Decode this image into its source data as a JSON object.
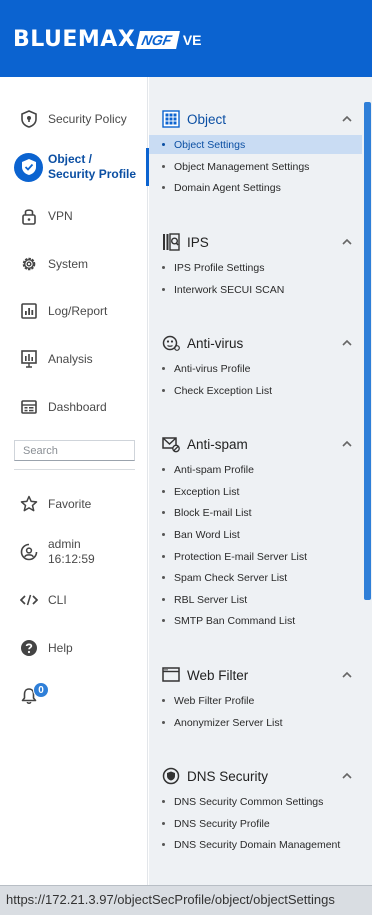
{
  "brand": {
    "name": "BLUEMAX",
    "product": "NGF",
    "edition": "VE"
  },
  "nav": {
    "items": [
      {
        "label": "Security Policy",
        "icon": "shield-icon"
      },
      {
        "label": "Object /",
        "label2": "Security Profile",
        "icon": "shield-check-icon",
        "active": true
      },
      {
        "label": "VPN",
        "icon": "lock-icon"
      },
      {
        "label": "System",
        "icon": "gear-icon"
      },
      {
        "label": "Log/Report",
        "icon": "chart-icon"
      },
      {
        "label": "Analysis",
        "icon": "analysis-icon"
      },
      {
        "label": "Dashboard",
        "icon": "dashboard-icon"
      }
    ],
    "search_placeholder": "Search",
    "favorite": "Favorite",
    "user": {
      "name": "admin",
      "time": "16:12:59"
    },
    "cli": "CLI",
    "help": "Help",
    "notifications": {
      "count": "0"
    }
  },
  "menu": {
    "sections": [
      {
        "title": "Object",
        "icon": "grid-icon",
        "items": [
          "Object Settings",
          "Object Management Settings",
          "Domain Agent Settings"
        ]
      },
      {
        "title": "IPS",
        "icon": "ips-icon",
        "items": [
          "IPS Profile Settings",
          "Interwork SECUI SCAN"
        ]
      },
      {
        "title": "Anti-virus",
        "icon": "virus-icon",
        "items": [
          "Anti-virus Profile",
          "Check Exception List"
        ]
      },
      {
        "title": "Anti-spam",
        "icon": "mail-icon",
        "items": [
          "Anti-spam Profile",
          "Exception List",
          "Block E-mail List",
          "Ban Word List",
          "Protection E-mail Server List",
          "Spam Check Server List",
          "RBL Server List",
          "SMTP Ban Command List"
        ]
      },
      {
        "title": "Web Filter",
        "icon": "web-icon",
        "items": [
          "Web Filter Profile",
          "Anonymizer Server List"
        ]
      },
      {
        "title": "DNS Security",
        "icon": "dns-icon",
        "items": [
          "DNS Security Common Settings",
          "DNS Security Profile",
          "DNS Security Domain Management"
        ]
      }
    ],
    "selected": "Object Settings"
  },
  "status_url": "https://172.21.3.97/objectSecProfile/object/objectSettings",
  "colors": {
    "brand_blue": "#0b63d0",
    "selected_bg": "#c9dcf3",
    "panel_bg": "#eef1f4"
  }
}
